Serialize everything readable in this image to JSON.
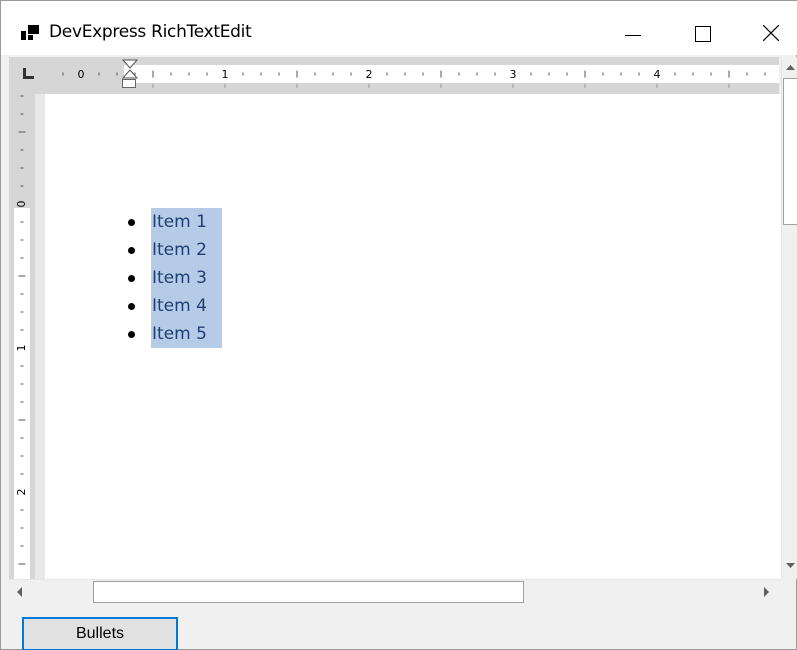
{
  "window": {
    "title": "DevExpress RichTextEdit"
  },
  "ruler": {
    "horizontal_marks": [
      "0",
      "1",
      "2",
      "3",
      "4"
    ],
    "vertical_marks": [
      "0",
      "1",
      "2"
    ]
  },
  "document": {
    "list_type": "bullet",
    "items": [
      "Item 1",
      "Item 2",
      "Item 3",
      "Item 4",
      "Item 5"
    ],
    "selection_color": "#b6cbe8"
  },
  "toolbar": {
    "bullets_label": "Bullets"
  },
  "colors": {
    "accent": "#0078d7",
    "selection": "#b6cbe8",
    "ruler": "#d6d6d6"
  }
}
